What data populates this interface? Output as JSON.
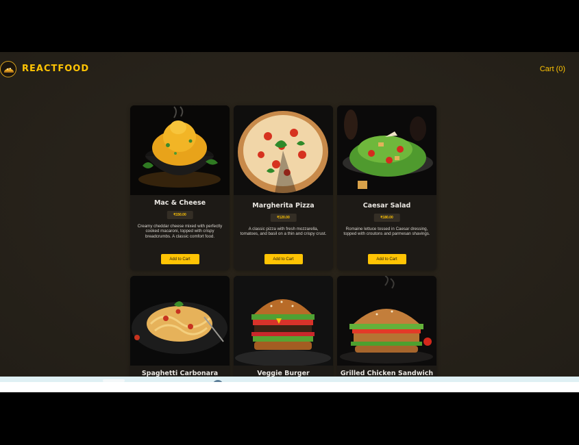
{
  "app": {
    "brand": "REACTFOOD",
    "cart_label": "Cart (0)"
  },
  "meals": [
    {
      "title": "Mac & Cheese",
      "price": "₹150.00",
      "description": "Creamy cheddar cheese mixed with perfectly cooked macaroni, topped with crispy breadcrumbs. A classic comfort food.",
      "button": "Add to Cart",
      "image": "mac-and-cheese-photo"
    },
    {
      "title": "Margherita Pizza",
      "price": "₹120.00",
      "description": "A classic pizza with fresh mozzarella, tomatoes, and basil on a thin and crispy crust.",
      "button": "Add to Cart",
      "image": "margherita-pizza-photo"
    },
    {
      "title": "Caesar Salad",
      "price": "₹180.00",
      "description": "Romaine lettuce tossed in Caesar dressing, topped with croutons and parmesan shavings.",
      "button": "Add to Cart",
      "image": "caesar-salad-photo"
    },
    {
      "title": "Spaghetti Carbonara",
      "image": "spaghetti-carbonara-photo"
    },
    {
      "title": "Veggie Burger",
      "image": "veggie-burger-photo"
    },
    {
      "title": "Grilled Chicken Sandwich",
      "image": "grilled-chicken-sandwich-photo"
    }
  ],
  "colors": {
    "accent": "#ffc404",
    "background": "#29241b",
    "card": "#1d1a16",
    "price_bg": "#342e25"
  }
}
